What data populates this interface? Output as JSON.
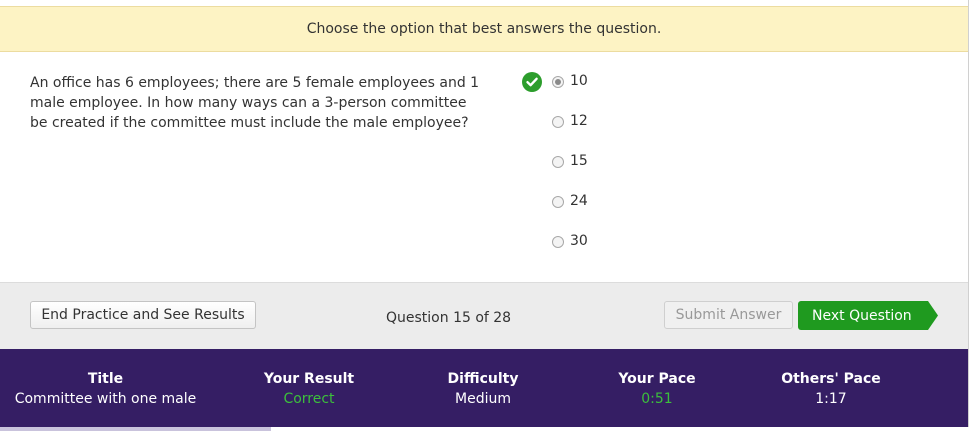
{
  "instructions": "Choose the option that best answers the question.",
  "question": {
    "text": "An office has 6 employees; there are 5 female employees and 1 male employee. In how many ways can a 3-person committee be created if the committee must include the male employee?"
  },
  "options": [
    {
      "label": "10",
      "selected": true,
      "correct": true
    },
    {
      "label": "12",
      "selected": false,
      "correct": false
    },
    {
      "label": "15",
      "selected": false,
      "correct": false
    },
    {
      "label": "24",
      "selected": false,
      "correct": false
    },
    {
      "label": "30",
      "selected": false,
      "correct": false
    }
  ],
  "toolbar": {
    "end_label": "End Practice and See Results",
    "question_count": "Question 15 of 28",
    "submit_label": "Submit Answer",
    "next_label": "Next Question"
  },
  "stats": {
    "title_header": "Title",
    "title_value": "Committee with one male",
    "result_header": "Your Result",
    "result_value": "Correct",
    "difficulty_header": "Difficulty",
    "difficulty_value": "Medium",
    "pace_header": "Your Pace",
    "pace_value": "0:51",
    "others_header": "Others' Pace",
    "others_value": "1:17"
  },
  "colors": {
    "banner": "#fdf3c4",
    "stats_bg": "#351e64",
    "accent_green": "#1f9a1f",
    "correct_green": "#3cbf3c"
  },
  "icons": {
    "correct": "check-circle-icon"
  }
}
